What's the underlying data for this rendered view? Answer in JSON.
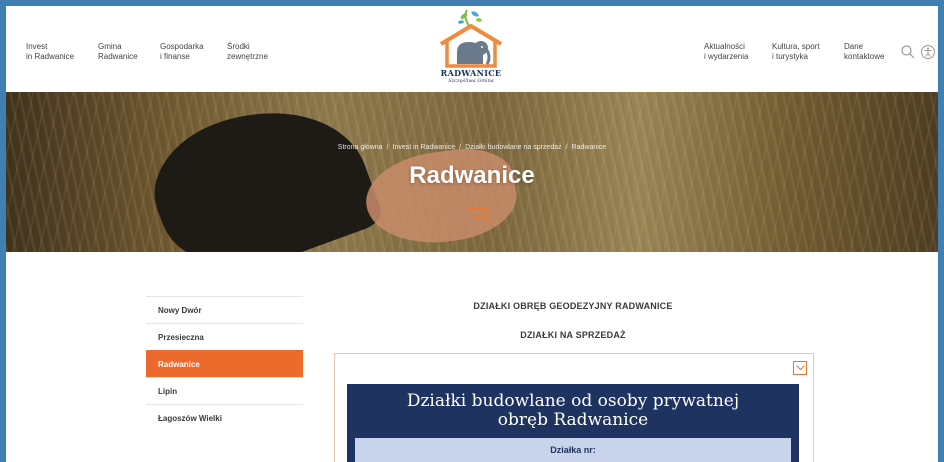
{
  "colors": {
    "accent": "#ec6b2c",
    "navy": "#1f3360",
    "frame": "#3f7fb3",
    "sub_panel": "#c9d3ec"
  },
  "nav_left": [
    {
      "line1": "Invest",
      "line2": "in Radwanice"
    },
    {
      "line1": "Gmina",
      "line2": "Radwanice"
    },
    {
      "line1": "Gospodarka",
      "line2": "i finanse"
    },
    {
      "line1": "Środki",
      "line2": "zewnętrzne"
    }
  ],
  "nav_right": [
    {
      "line1": "Aktualności",
      "line2": "i wydarzenia"
    },
    {
      "line1": "Kultura, sport",
      "line2": "i turystyka"
    },
    {
      "line1": "Dane",
      "line2": "kontaktowe"
    }
  ],
  "logo": {
    "name": "RADWANICE",
    "tagline": "Szczęśliwa Gmina"
  },
  "icons": {
    "search": "search-icon",
    "accessibility": "accessibility-icon",
    "hero_chevron": "chevron-down-icon",
    "panel_toggle": "chevron-down-icon"
  },
  "hero": {
    "breadcrumb": [
      "Strona główna",
      "Invest in Radwanice",
      "Działki budowlane na sprzedaż",
      "Radwanice"
    ],
    "title": "Radwanice"
  },
  "sidebar": {
    "items": [
      {
        "label": "Nowy Dwór",
        "active": false
      },
      {
        "label": "Przesieczna",
        "active": false
      },
      {
        "label": "Radwanice",
        "active": true
      },
      {
        "label": "Lipin",
        "active": false
      },
      {
        "label": "Łagoszów Wielki",
        "active": false
      }
    ]
  },
  "main": {
    "heading1": "DZIAŁKI OBRĘB GEODEZYJNY RADWANICE",
    "heading2": "DZIAŁKI NA SPRZEDAŻ",
    "card_title_line1": "Działki budowlane od osoby prywatnej",
    "card_title_line2": "obręb Radwanice",
    "card_sub_label": "Działka nr:"
  }
}
